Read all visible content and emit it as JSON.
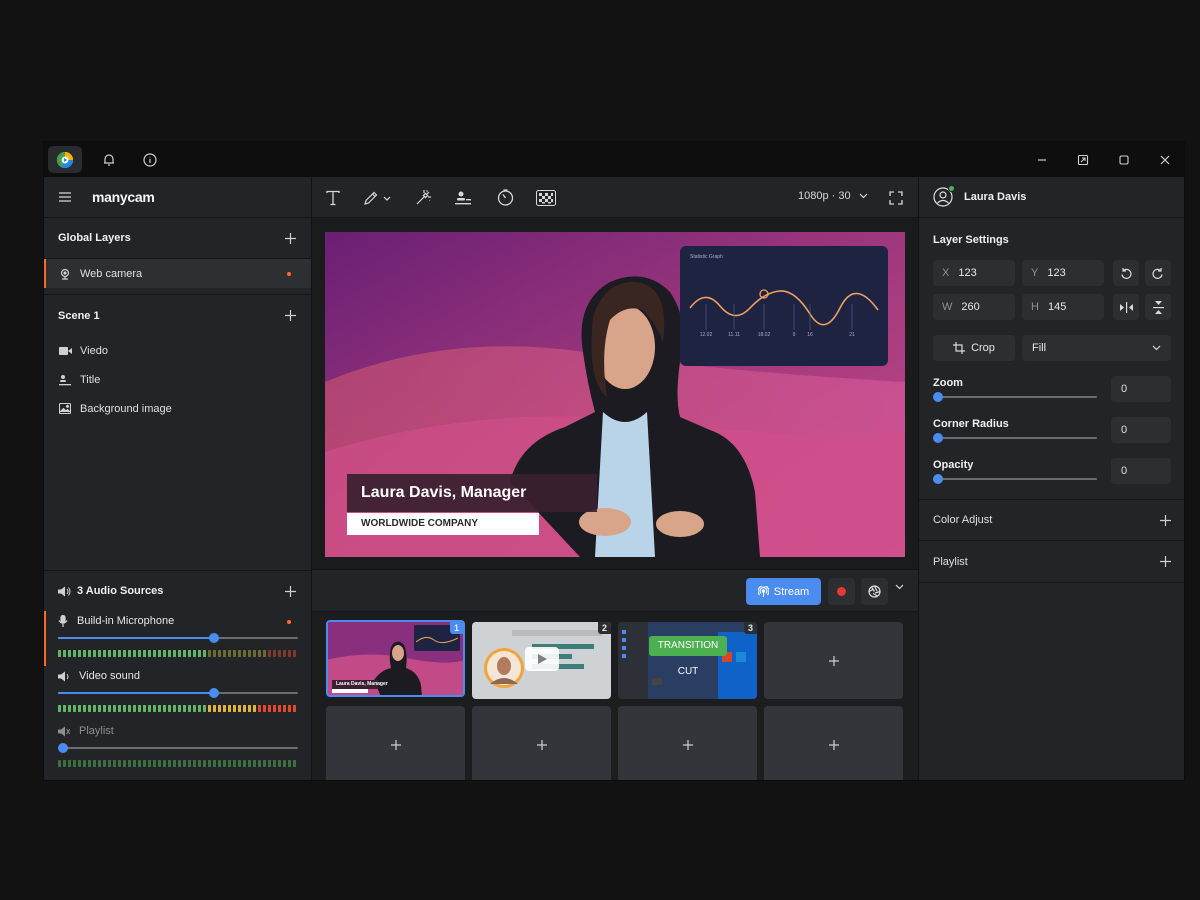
{
  "app": {
    "brand": "manycam"
  },
  "left": {
    "global_layers": {
      "title": "Global Layers",
      "items": [
        {
          "label": "Web camera"
        }
      ]
    },
    "scene": {
      "title": "Scene 1",
      "items": [
        {
          "label": "Viedo"
        },
        {
          "label": "Title"
        },
        {
          "label": "Background image"
        }
      ]
    },
    "audio": {
      "title": "3 Audio Sources",
      "sources": [
        {
          "label": "Build-in Microphone",
          "level": 0.65
        },
        {
          "label": "Video sound",
          "level": 0.65
        },
        {
          "label": "Playlist",
          "level": 0.0
        }
      ]
    }
  },
  "toolbar": {
    "resolution": "1080p · 30"
  },
  "preview": {
    "lower_third_name": "Laura Davis, Manager",
    "lower_third_company": "WORLDWIDE COMPANY",
    "graph_title": "Statistic Graph",
    "graph_labels": [
      "12.02",
      "11.11",
      "18.02",
      "9",
      "16",
      "21"
    ]
  },
  "controls": {
    "stream_label": "Stream"
  },
  "scenes": {
    "items": [
      {
        "num": "1",
        "caption": "Laura Davis, Manager"
      },
      {
        "num": "2"
      },
      {
        "num": "3",
        "transition": "TRANSITION",
        "cut": "CUT"
      }
    ]
  },
  "right": {
    "user": {
      "name": "Laura Davis"
    },
    "layer_settings": {
      "title": "Layer Settings",
      "x_label": "X",
      "x": "123",
      "y_label": "Y",
      "y": "123",
      "w_label": "W",
      "w": "260",
      "h_label": "H",
      "h": "145",
      "crop_label": "Crop",
      "fill_value": "Fill",
      "zoom_label": "Zoom",
      "zoom": "0",
      "radius_label": "Corner Radius",
      "radius": "0",
      "opacity_label": "Opacity",
      "opacity": "0"
    },
    "color_adjust": "Color Adjust",
    "playlist": "Playlist"
  },
  "colors": {
    "accent": "#4a8cf0",
    "record": "#e53935",
    "live_dot": "#ff6a2a",
    "green": "#4caf50"
  }
}
